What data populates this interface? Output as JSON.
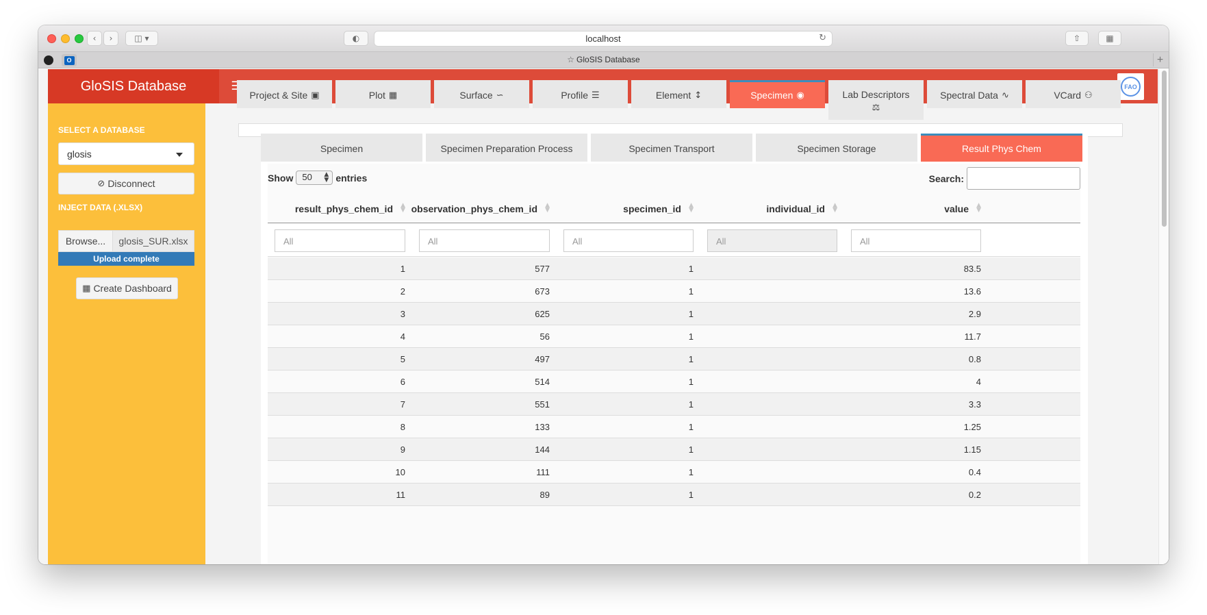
{
  "browser": {
    "url": "localhost",
    "tab_title": "GloSIS Database"
  },
  "app": {
    "title": "GloSIS Database",
    "colors": {
      "header": "#dd4b39",
      "sidebar": "#fcbf3b",
      "active_tab": "#f96a55",
      "active_border": "#3c8dbc",
      "progress": "#337ab7"
    }
  },
  "sidebar": {
    "select_db_label": "SELECT A DATABASE",
    "selected_db": "glosis",
    "disconnect_label": "Disconnect",
    "inject_label": "INJECT DATA (.xlsx)",
    "browse_label": "Browse...",
    "file_name": "glosis_SUR.xlsx",
    "upload_status": "Upload complete",
    "create_dashboard_label": "Create Dashboard"
  },
  "main_tabs": [
    {
      "label": "Project & Site",
      "icon": "image-icon"
    },
    {
      "label": "Plot",
      "icon": "map-icon"
    },
    {
      "label": "Surface",
      "icon": "route-icon"
    },
    {
      "label": "Profile",
      "icon": "layers-icon"
    },
    {
      "label": "Element",
      "icon": "arrows-vertical-icon"
    },
    {
      "label": "Specimen",
      "icon": "sack-icon",
      "active": true
    },
    {
      "label": "Lab Descriptors",
      "icon": "flask-icon"
    },
    {
      "label": "Spectral Data",
      "icon": "signature-icon"
    },
    {
      "label": "VCard",
      "icon": "person-icon"
    }
  ],
  "sub_tabs": [
    {
      "label": "Specimen"
    },
    {
      "label": "Specimen Preparation Process"
    },
    {
      "label": "Specimen Transport"
    },
    {
      "label": "Specimen Storage"
    },
    {
      "label": "Result Phys Chem",
      "active": true
    }
  ],
  "datatable": {
    "show_label": "Show",
    "page_length": "50",
    "entries_label": "entries",
    "search_label": "Search:",
    "columns": [
      "result_phys_chem_id",
      "observation_phys_chem_id",
      "specimen_id",
      "individual_id",
      "value"
    ],
    "filter_placeholder": "All",
    "rows": [
      [
        "1",
        "577",
        "1",
        "",
        "83.5"
      ],
      [
        "2",
        "673",
        "1",
        "",
        "13.6"
      ],
      [
        "3",
        "625",
        "1",
        "",
        "2.9"
      ],
      [
        "4",
        "56",
        "1",
        "",
        "11.7"
      ],
      [
        "5",
        "497",
        "1",
        "",
        "0.8"
      ],
      [
        "6",
        "514",
        "1",
        "",
        "4"
      ],
      [
        "7",
        "551",
        "1",
        "",
        "3.3"
      ],
      [
        "8",
        "133",
        "1",
        "",
        "1.25"
      ],
      [
        "9",
        "144",
        "1",
        "",
        "1.15"
      ],
      [
        "10",
        "111",
        "1",
        "",
        "0.4"
      ],
      [
        "11",
        "89",
        "1",
        "",
        "0.2"
      ]
    ]
  }
}
